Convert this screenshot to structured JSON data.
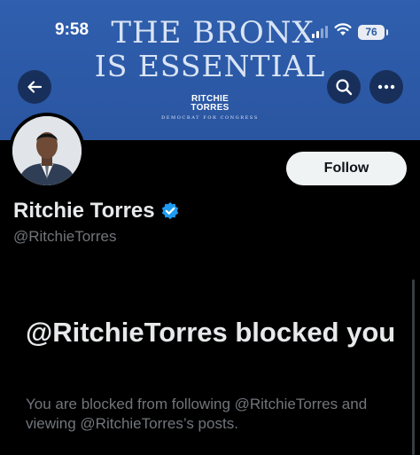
{
  "status_bar": {
    "time": "9:58",
    "battery": "76"
  },
  "banner": {
    "line1": "THE BRONX",
    "line2": "IS ESSENTIAL",
    "name_line1": "RITCHIE",
    "name_line2": "TORRES",
    "tagline": "DEMOCRAT FOR CONGRESS",
    "color": "#2c5aa6"
  },
  "toolbar": {
    "back_icon": "arrow-left-icon",
    "search_icon": "search-icon",
    "more_icon": "more-horizontal-icon"
  },
  "profile": {
    "display_name": "Ritchie Torres",
    "handle": "@RitchieTorres",
    "verified": true,
    "verified_color": "#1d9bf0",
    "follow_label": "Follow"
  },
  "blocked": {
    "title": "@RitchieTorres blocked you",
    "description": "You are blocked from following @RitchieTorres and viewing @RitchieTorres’s posts."
  }
}
